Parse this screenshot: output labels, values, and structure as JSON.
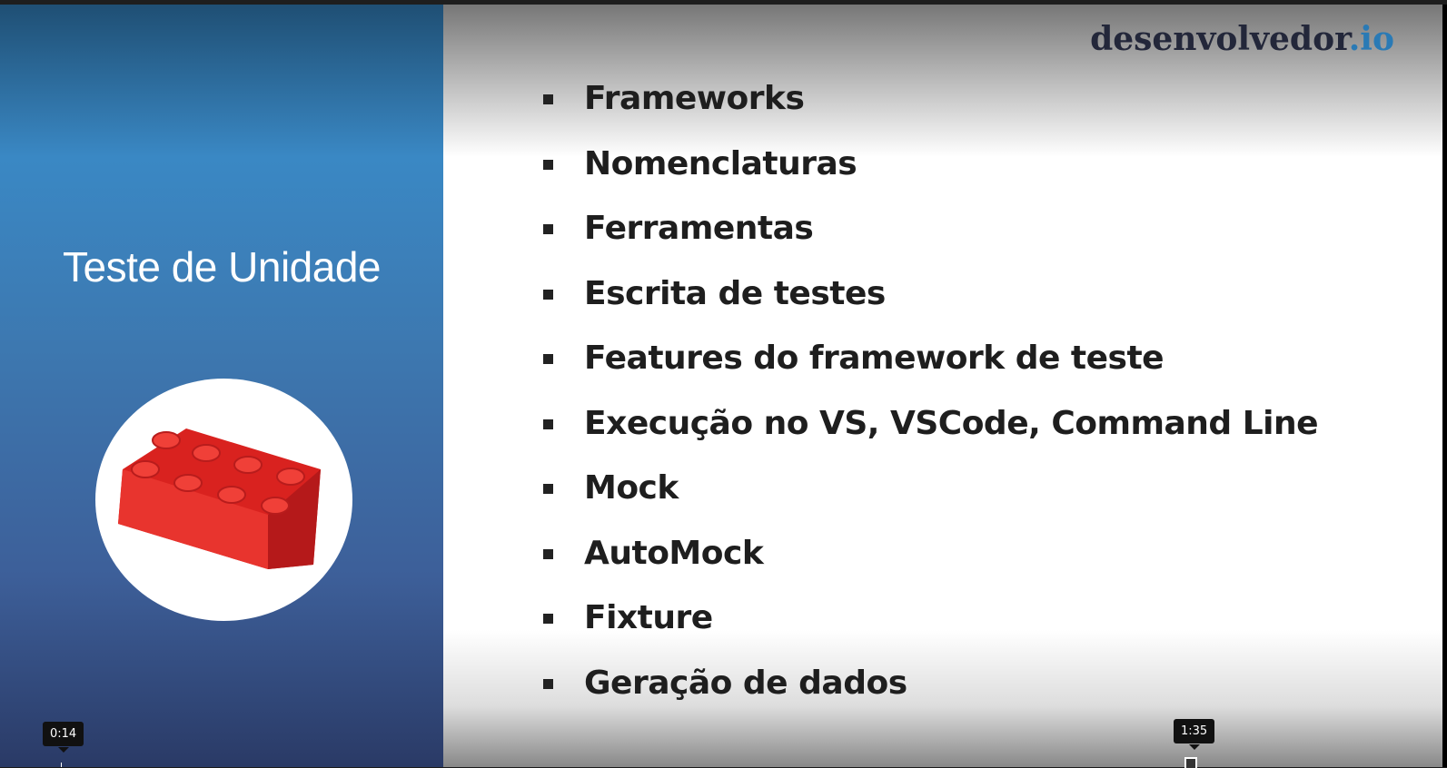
{
  "slide": {
    "title": "Teste de Unidade",
    "logo": {
      "main": "desenvolvedor",
      "suffix": ".io"
    },
    "bullets": [
      "Frameworks",
      "Nomenclaturas",
      "Ferramentas",
      "Escrita de testes",
      "Features do framework de teste",
      "Execução no VS, VSCode, Command Line",
      "Mock",
      "AutoMock",
      "Fixture",
      "Geração de dados"
    ]
  },
  "player": {
    "hover_time": "0:14",
    "current_time": "1:35"
  },
  "colors": {
    "accent": "#2a7ab5",
    "brick": "#e0282a"
  }
}
